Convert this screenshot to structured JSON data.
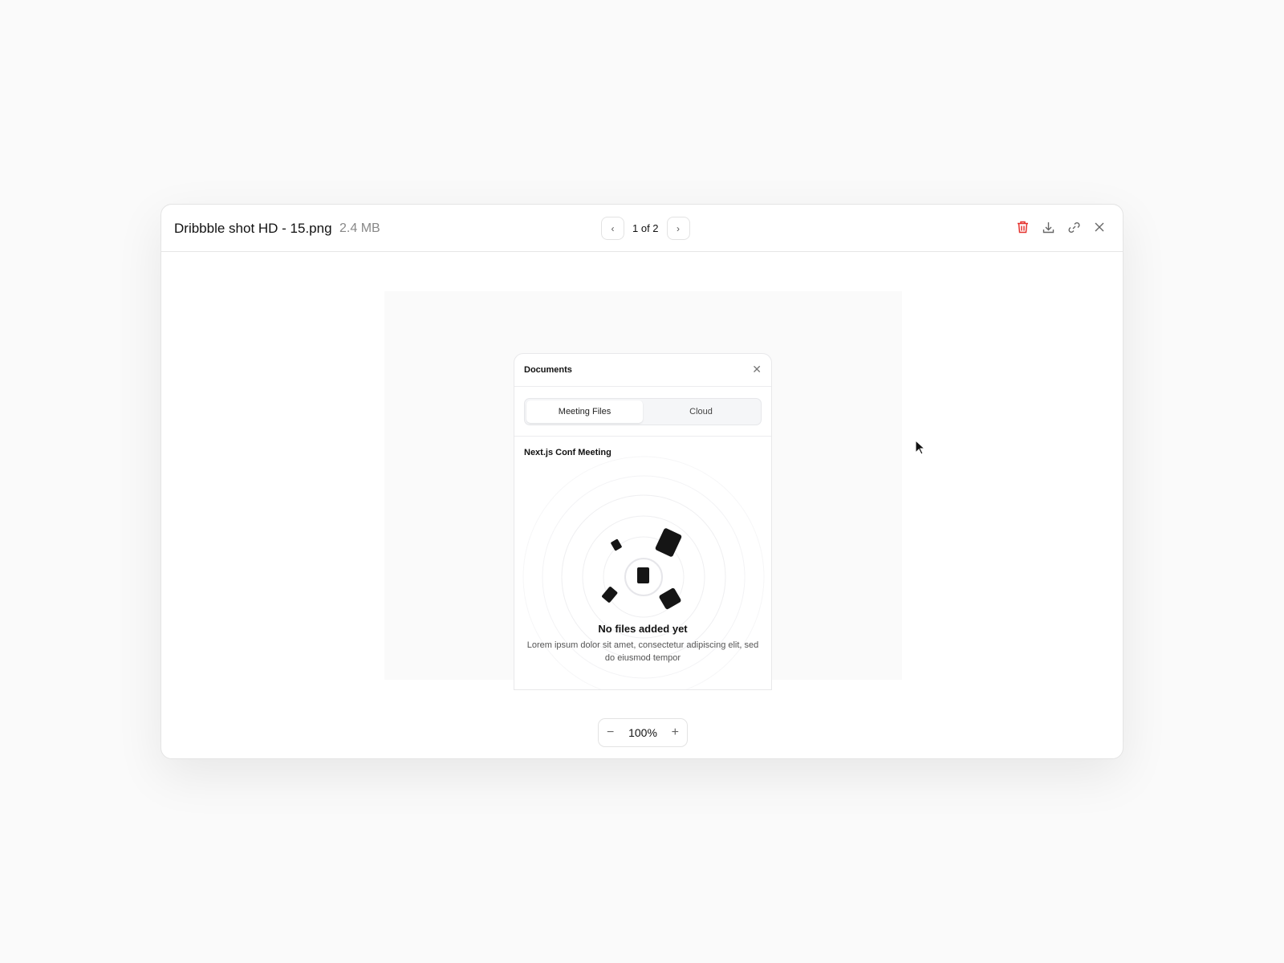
{
  "viewer": {
    "file_name": "Dribbble shot HD - 15.png",
    "file_size": "2.4 MB",
    "pager": "1 of 2",
    "prev_icon": "chevron-left-icon",
    "next_icon": "chevron-right-icon",
    "actions": [
      "trash-icon",
      "download-icon",
      "link-icon",
      "close-icon"
    ],
    "delete_color": "#e5322d",
    "zoom_level": "100%",
    "zoom_out": "−",
    "zoom_in": "+"
  },
  "preview": {
    "card_title": "Documents",
    "tabs": [
      {
        "label": "Meeting Files",
        "active": true
      },
      {
        "label": "Cloud",
        "active": false
      }
    ],
    "section_title": "Next.js Conf Meeting",
    "empty_title": "No files added yet",
    "empty_desc": "Lorem ipsum dolor sit amet, consectetur adipiscing elit, sed do eiusmod tempor"
  }
}
